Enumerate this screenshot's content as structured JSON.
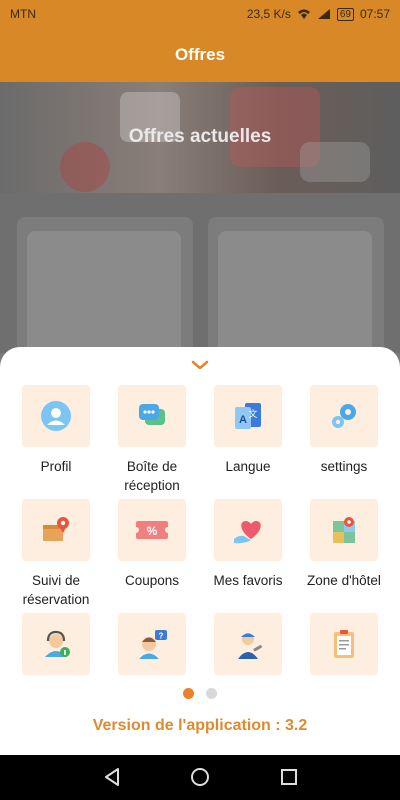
{
  "status_bar": {
    "carrier": "MTN",
    "speed": "23,5 K/s",
    "battery": "69",
    "time": "07:57"
  },
  "app_bar": {
    "title": "Offres"
  },
  "hero": {
    "title": "Offres actuelles"
  },
  "sheet": {
    "items": [
      {
        "label": "Profil",
        "icon": "profile-icon"
      },
      {
        "label": "Boîte de réception",
        "icon": "chat-icon"
      },
      {
        "label": "Langue",
        "icon": "translate-icon"
      },
      {
        "label": "settings",
        "icon": "gear-icon"
      },
      {
        "label": "Suivi de réservation",
        "icon": "package-location-icon"
      },
      {
        "label": "Coupons",
        "icon": "coupon-icon"
      },
      {
        "label": "Mes favoris",
        "icon": "heart-hand-icon"
      },
      {
        "label": "Zone d'hôtel",
        "icon": "map-icon"
      },
      {
        "label": "",
        "icon": "support-agent-icon"
      },
      {
        "label": "",
        "icon": "faq-person-icon"
      },
      {
        "label": "",
        "icon": "mechanic-icon"
      },
      {
        "label": "",
        "icon": "clipboard-icon"
      }
    ],
    "version": "Version de l'application : 3.2"
  },
  "colors": {
    "accent": "#e8832a",
    "tile_bg": "#fdeee0"
  }
}
